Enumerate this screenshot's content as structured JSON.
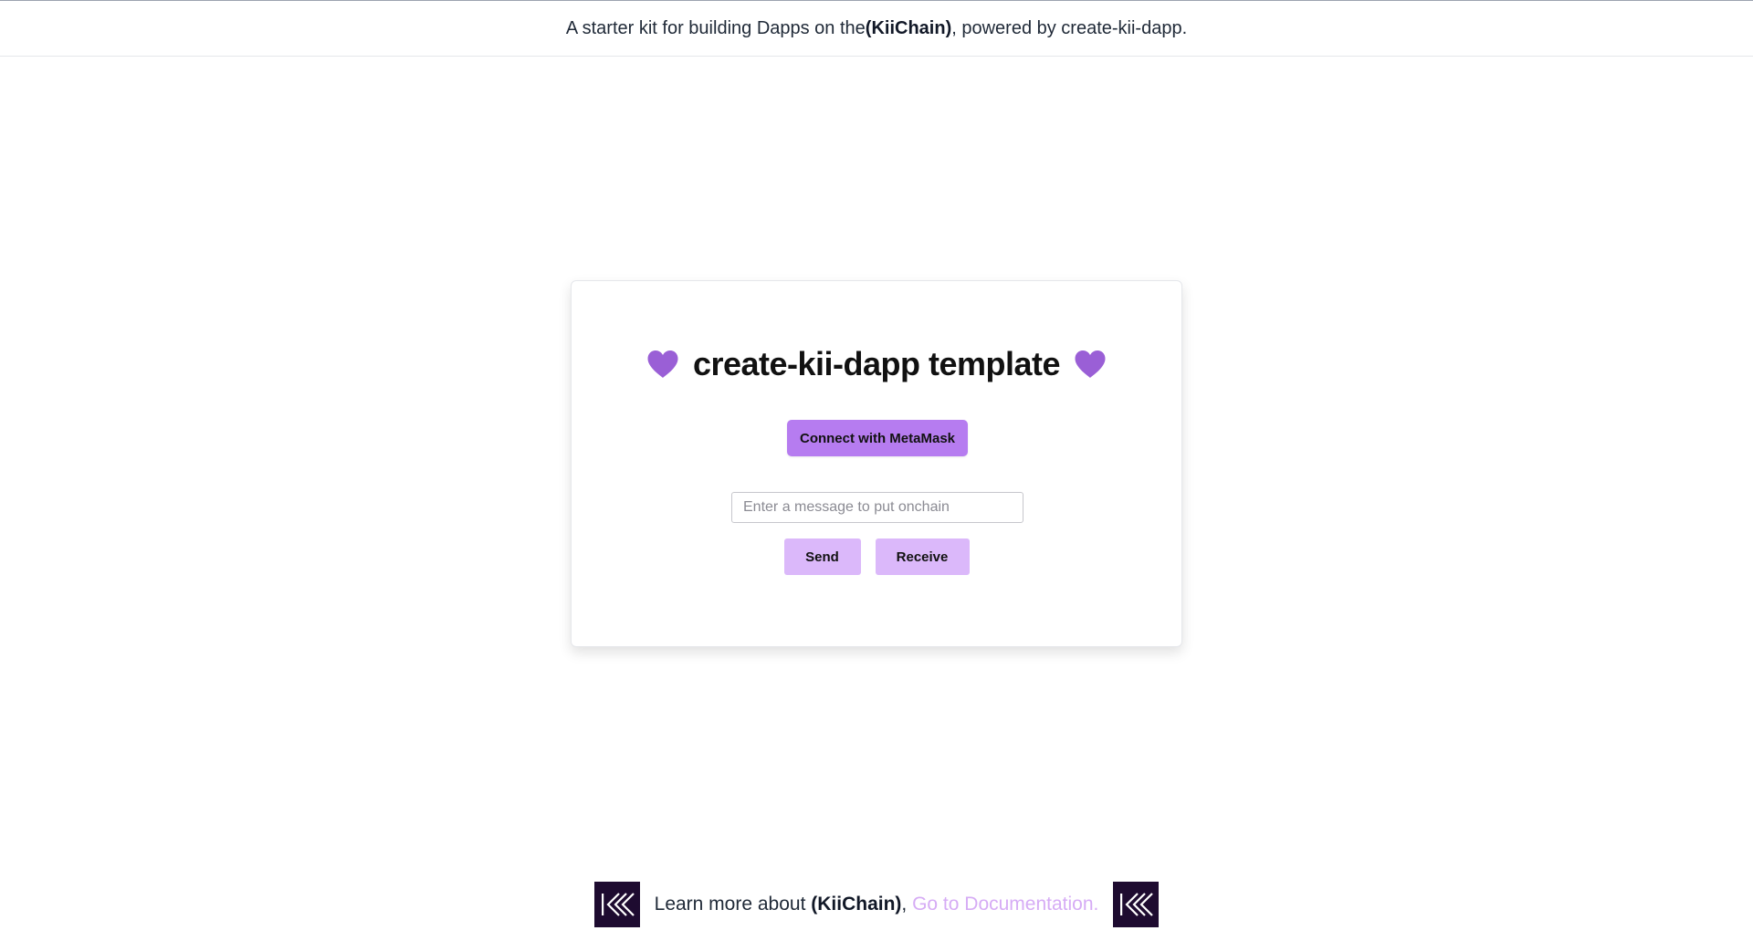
{
  "banner": {
    "text_before": "A starter kit for building Dapps on the ",
    "brand": "(KiiChain)",
    "text_after": ", powered by create-kii-dapp."
  },
  "card": {
    "title": "create-kii-dapp template",
    "left_icon": "purple-heart-icon",
    "right_icon": "purple-heart-icon",
    "connect_label": "Connect with MetaMask",
    "message_input": {
      "value": "",
      "placeholder": "Enter a message to put onchain"
    },
    "send_label": "Send",
    "receive_label": "Receive"
  },
  "footer": {
    "text_before": "Learn more about ",
    "brand": "(KiiChain)",
    "separator": ", ",
    "link_label": "Go to Documentation.",
    "left_logo": "kiichain-logo-icon",
    "right_logo": "kiichain-logo-icon"
  },
  "colors": {
    "heart": "#9a5fd6",
    "connect_button": "#b67cf0",
    "action_button": "#dbb8fa",
    "doc_link": "#d6acf5",
    "logo_background": "#1e0b30"
  }
}
